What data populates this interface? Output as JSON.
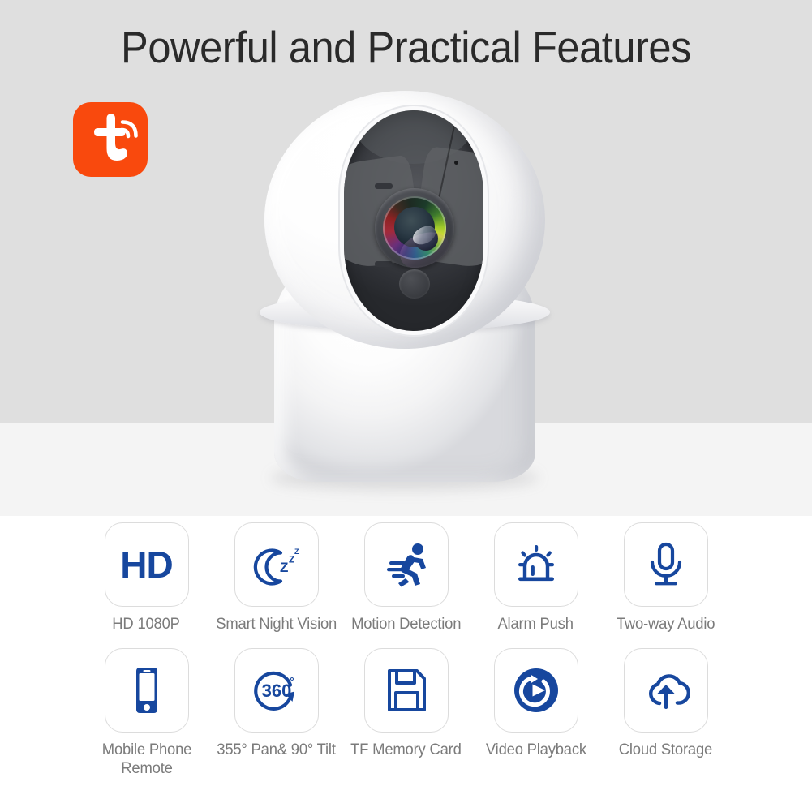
{
  "page": {
    "title": "Powerful and Practical Features",
    "background_bands": [
      "#dfdfdf",
      "#f4f4f4",
      "#ffffff"
    ]
  },
  "brand": {
    "logo_name": "tuya-logo",
    "logo_letter": "t",
    "logo_color": "#f9490d",
    "logo_mark_color": "#ffffff"
  },
  "product": {
    "name": "pan-tilt-security-camera",
    "body_color": "#ffffff",
    "face_color": "#3a3c41",
    "lens_accent": "#9ec92a"
  },
  "theme": {
    "icon_blue": "#17479e",
    "label_gray": "#7b7b7b",
    "tile_border": "#dcdcdc",
    "title_color": "#2a2a2a"
  },
  "features": {
    "row1": [
      {
        "icon": "hd-icon",
        "icon_text": "HD",
        "label": "HD 1080P"
      },
      {
        "icon": "moon-zzz-icon",
        "label": "Smart Night Vision"
      },
      {
        "icon": "running-person-icon",
        "label": "Motion Detection"
      },
      {
        "icon": "siren-alarm-icon",
        "label": "Alarm Push"
      },
      {
        "icon": "microphone-icon",
        "label": "Two-way Audio"
      }
    ],
    "row2": [
      {
        "icon": "smartphone-icon",
        "label": "Mobile Phone Remote"
      },
      {
        "icon": "rotation-360-icon",
        "icon_text": "360",
        "icon_sup": "°",
        "label": "355° Pan& 90° Tilt"
      },
      {
        "icon": "floppy-disk-icon",
        "label": "TF Memory Card"
      },
      {
        "icon": "video-playback-icon",
        "label": "Video Playback"
      },
      {
        "icon": "cloud-upload-icon",
        "label": "Cloud Storage"
      }
    ]
  }
}
